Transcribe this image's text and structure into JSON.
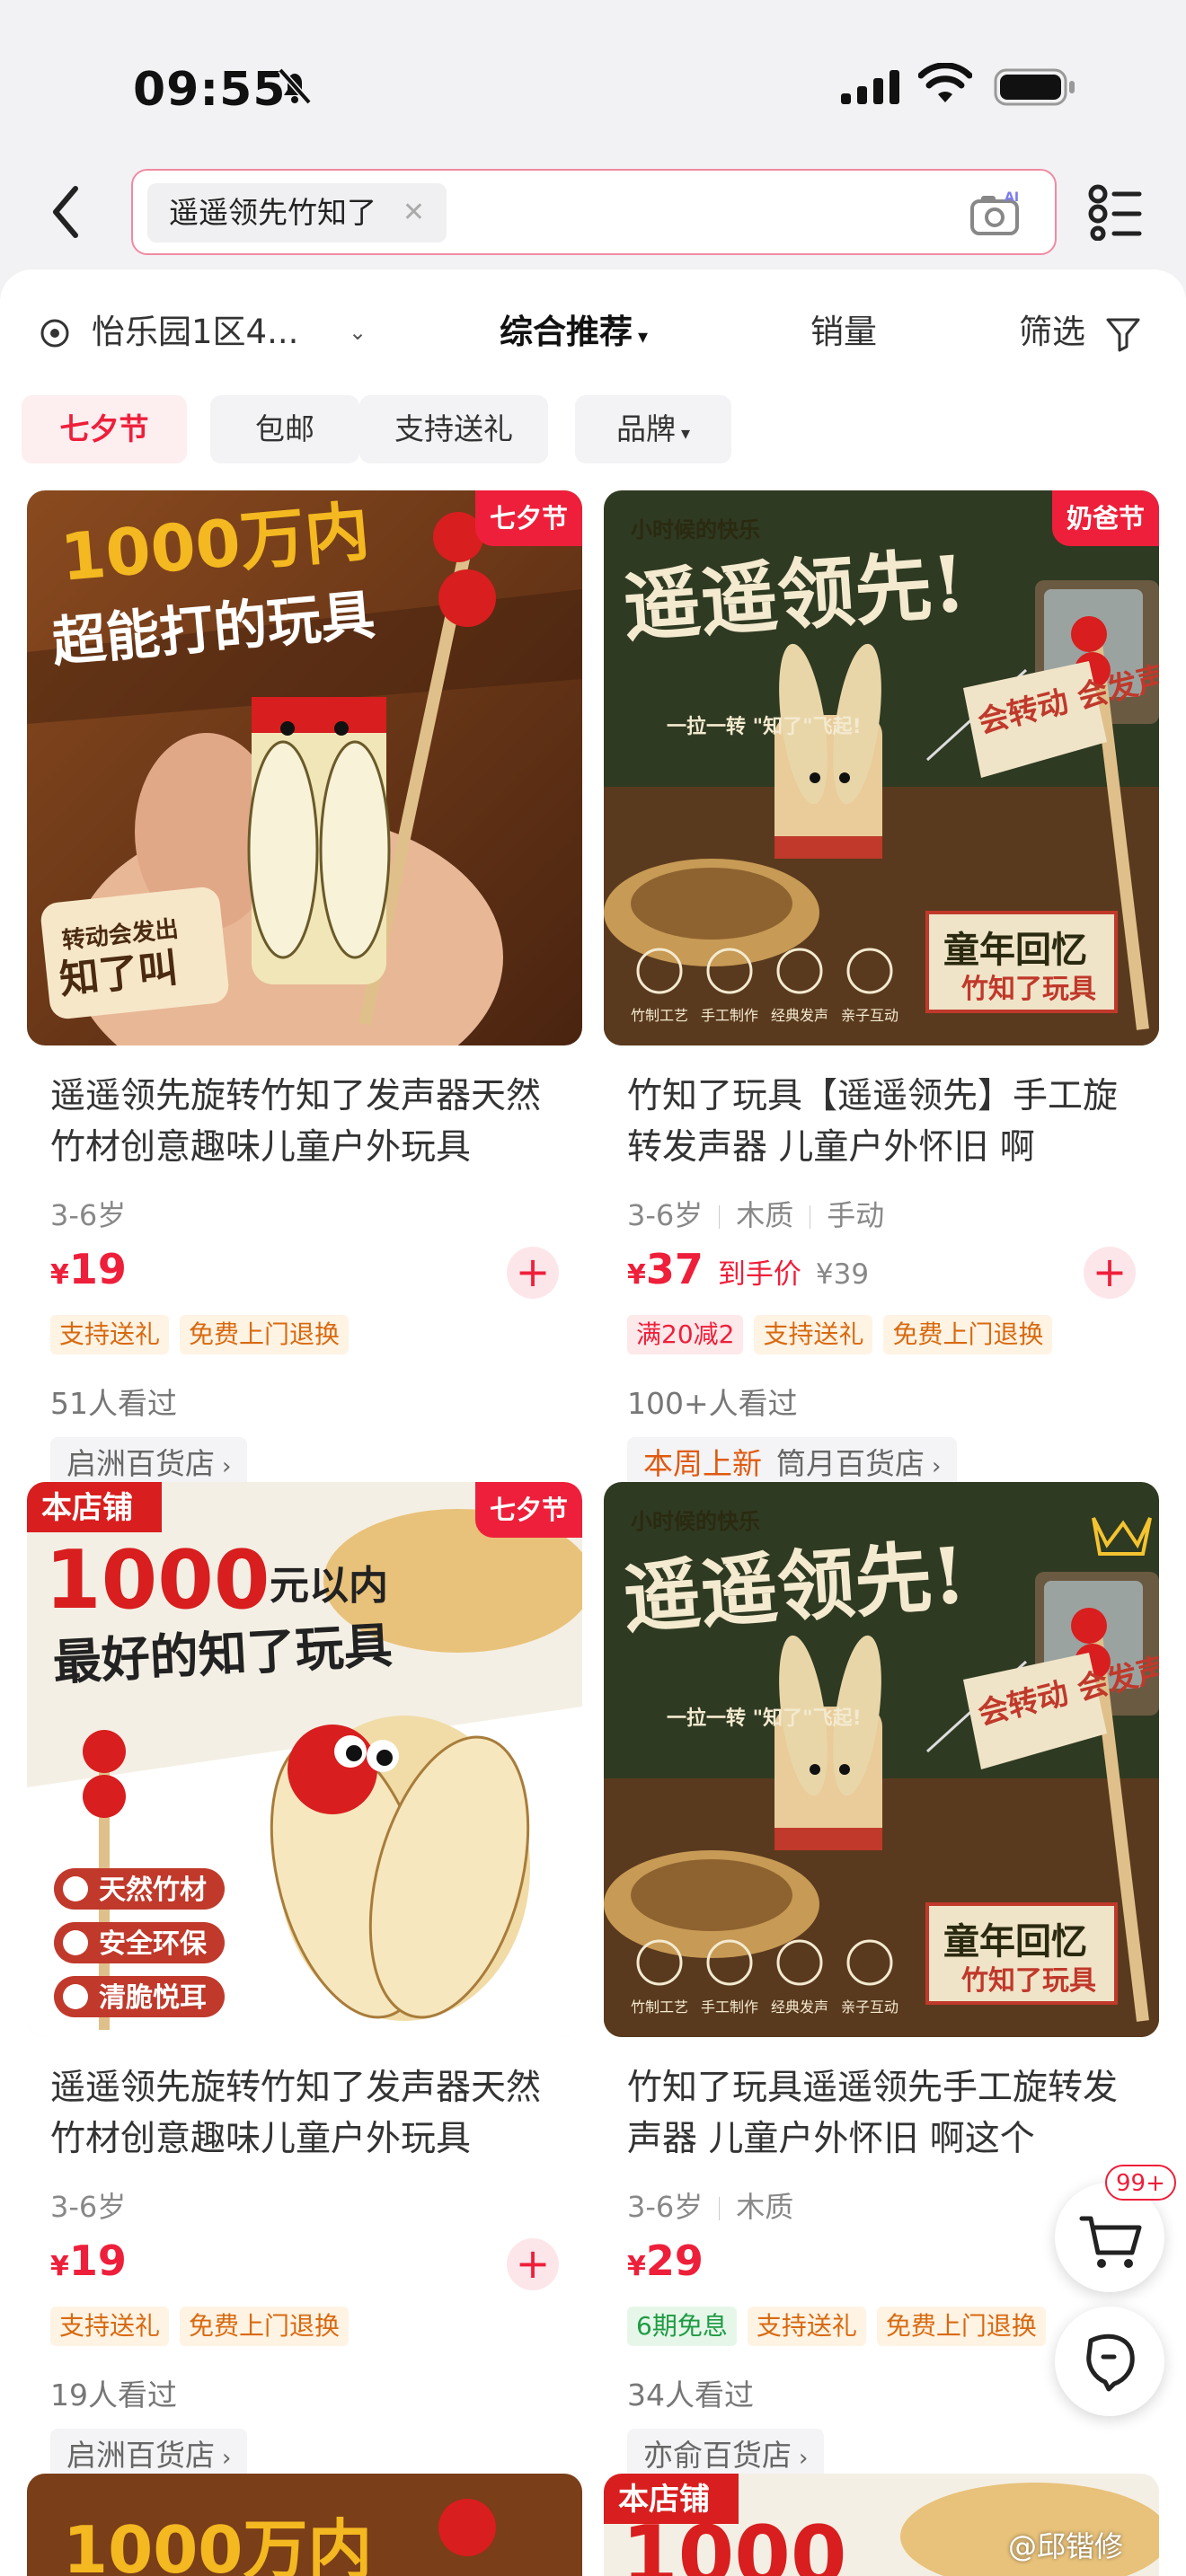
{
  "status_bar": {
    "time": "09:55"
  },
  "search": {
    "query": "遥遥领先竹知了"
  },
  "filter_bar": {
    "location": "怡乐园1区4...",
    "sort": "综合推荐",
    "sales": "销量",
    "filter": "筛选"
  },
  "tags": [
    "七夕节",
    "包邮",
    "支持送礼",
    "品牌"
  ],
  "products": [
    {
      "badge": "七夕节",
      "image_text": {
        "head1": "1000万内",
        "head2": "超能打的玩具",
        "note1": "转动会发出",
        "note2": "知了叫"
      },
      "title": "遥遥领先旋转竹知了发声器天然竹材创意趣味儿童户外玩具",
      "attrs": [
        "3-6岁"
      ],
      "currency": "¥",
      "price": "19",
      "after_price": "",
      "orig_price": "",
      "promos": [
        {
          "text": "支持送礼",
          "style": "orange"
        },
        {
          "text": "免费上门退换",
          "style": "orange"
        }
      ],
      "views": "51人看过",
      "store_new": "",
      "store": "启洲百货店"
    },
    {
      "badge": "奶爸节",
      "image_text": {
        "small": "小时候的快乐",
        "head1": "遥遥领先!",
        "mid": "一拉一转\n\"知了\"飞起!",
        "sticker": "会转动\n会发声",
        "box1": "童年回忆",
        "box2": "竹知了玩具",
        "features": [
          "竹制工艺",
          "手工制作",
          "经典发声",
          "亲子互动"
        ]
      },
      "title": "竹知了玩具【遥遥领先】手工旋转发声器 儿童户外怀旧 啊",
      "attrs": [
        "3-6岁",
        "木质",
        "手动"
      ],
      "currency": "¥",
      "price": "37",
      "after_price": "到手价",
      "orig_price": "¥39",
      "promos": [
        {
          "text": "满20减2",
          "style": "red"
        },
        {
          "text": "支持送礼",
          "style": "orange"
        },
        {
          "text": "免费上门退换",
          "style": "orange"
        }
      ],
      "views": "100+人看过",
      "store_new": "本周上新",
      "store": "筒月百货店"
    },
    {
      "badge": "七夕节",
      "image_text": {
        "shop": "本店铺",
        "head1": "1000",
        "head1b": "元以内",
        "head2": "最好的知了玩具",
        "checks": [
          "天然竹材",
          "安全环保",
          "清脆悦耳"
        ]
      },
      "title": "遥遥领先旋转竹知了发声器天然竹材创意趣味儿童户外玩具",
      "attrs": [
        "3-6岁"
      ],
      "currency": "¥",
      "price": "19",
      "after_price": "",
      "orig_price": "",
      "promos": [
        {
          "text": "支持送礼",
          "style": "orange"
        },
        {
          "text": "免费上门退换",
          "style": "orange"
        }
      ],
      "views": "19人看过",
      "store_new": "",
      "store": "启洲百货店"
    },
    {
      "badge": "",
      "image_text": {
        "small": "小时候的快乐",
        "head1": "遥遥领先!",
        "mid": "一拉一转\n\"知了\"飞起!",
        "sticker": "会转动\n会发声",
        "box1": "童年回忆",
        "box2": "竹知了玩具",
        "features": [
          "竹制工艺",
          "手工制作",
          "经典发声",
          "亲子互动"
        ]
      },
      "title": "竹知了玩具遥遥领先手工旋转发声器 儿童户外怀旧 啊这个",
      "attrs": [
        "3-6岁",
        "木质"
      ],
      "currency": "¥",
      "price": "29",
      "after_price": "",
      "orig_price": "",
      "promos": [
        {
          "text": "6期免息",
          "style": "green"
        },
        {
          "text": "支持送礼",
          "style": "orange"
        },
        {
          "text": "免费上门退换",
          "style": "orange"
        }
      ],
      "views": "34人看过",
      "store_new": "",
      "store": "亦俞百货店"
    }
  ],
  "cart": {
    "count": "99+"
  },
  "watermark": "@邱锴修",
  "colors": {
    "accent": "#ee1f3a",
    "search_border": "#f08aa2",
    "promo_orange": "#d86a10",
    "promo_green": "#1f9b43"
  }
}
